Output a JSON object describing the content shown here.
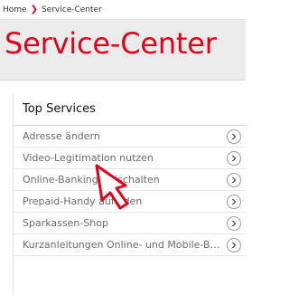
{
  "breadcrumb": {
    "home": "Home",
    "current": "Service-Center"
  },
  "page": {
    "title": "Service-Center"
  },
  "top_services": {
    "heading": "Top Services",
    "items": [
      {
        "label": "Adresse ändern"
      },
      {
        "label": "Video-Legitimation nutzen"
      },
      {
        "label": "Online-Banking freischalten"
      },
      {
        "label": "Prepaid-Handy aufladen"
      },
      {
        "label": "Sparkassen-Shop"
      },
      {
        "label": "Kurzanleitungen Online- und Mobile-Banking"
      }
    ]
  },
  "colors": {
    "accent": "#e2001a",
    "hero_bg": "#ebebeb",
    "text_muted": "#6b6b6b"
  },
  "icons": {
    "breadcrumb_separator": "chevron-right-icon",
    "row_action": "circle-chevron-right-icon",
    "pointer": "hand-pointer-icon"
  }
}
